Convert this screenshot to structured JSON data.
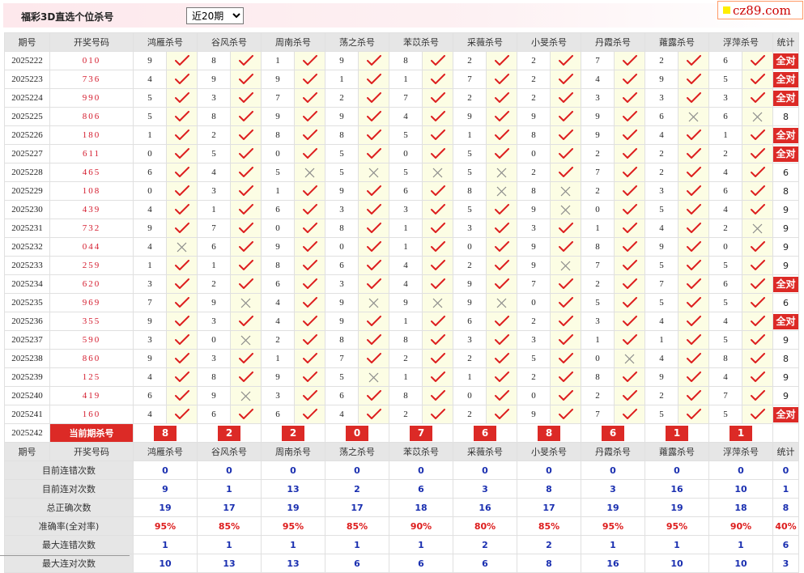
{
  "header": {
    "title": "福彩3D直选个位杀号",
    "period_select": {
      "selected": "近20期"
    },
    "logo_text": "cz89.com"
  },
  "table": {
    "headers": [
      "期号",
      "开奖号码",
      "鸿雁杀号",
      "谷风杀号",
      "周南杀号",
      "荡之杀号",
      "苯苡杀号",
      "采薇杀号",
      "小旻杀号",
      "丹霞杀号",
      "蕹露杀号",
      "浮萍杀号",
      "统计"
    ],
    "all_correct_label": "全对",
    "rows": [
      {
        "period": "2025222",
        "draw": "010",
        "kills": [
          9,
          8,
          1,
          9,
          8,
          2,
          2,
          7,
          2,
          6
        ],
        "marks": [
          1,
          1,
          1,
          1,
          1,
          1,
          1,
          1,
          1,
          1
        ],
        "stat": "全对"
      },
      {
        "period": "2025223",
        "draw": "736",
        "kills": [
          4,
          9,
          9,
          1,
          1,
          7,
          2,
          4,
          9,
          5
        ],
        "marks": [
          1,
          1,
          1,
          1,
          1,
          1,
          1,
          1,
          1,
          1
        ],
        "stat": "全对"
      },
      {
        "period": "2025224",
        "draw": "990",
        "kills": [
          5,
          3,
          7,
          2,
          7,
          2,
          2,
          3,
          3,
          3
        ],
        "marks": [
          1,
          1,
          1,
          1,
          1,
          1,
          1,
          1,
          1,
          1
        ],
        "stat": "全对"
      },
      {
        "period": "2025225",
        "draw": "806",
        "kills": [
          5,
          8,
          9,
          9,
          4,
          9,
          9,
          9,
          6,
          6
        ],
        "marks": [
          1,
          1,
          1,
          1,
          1,
          1,
          1,
          1,
          0,
          0
        ],
        "stat": "8"
      },
      {
        "period": "2025226",
        "draw": "180",
        "kills": [
          1,
          2,
          8,
          8,
          5,
          1,
          8,
          9,
          4,
          1
        ],
        "marks": [
          1,
          1,
          1,
          1,
          1,
          1,
          1,
          1,
          1,
          1
        ],
        "stat": "全对"
      },
      {
        "period": "2025227",
        "draw": "611",
        "kills": [
          0,
          5,
          0,
          5,
          0,
          5,
          0,
          2,
          2,
          2
        ],
        "marks": [
          1,
          1,
          1,
          1,
          1,
          1,
          1,
          1,
          1,
          1
        ],
        "stat": "全对"
      },
      {
        "period": "2025228",
        "draw": "465",
        "kills": [
          6,
          4,
          5,
          5,
          5,
          5,
          2,
          7,
          2,
          4
        ],
        "marks": [
          1,
          1,
          0,
          0,
          0,
          0,
          1,
          1,
          1,
          1
        ],
        "stat": "6"
      },
      {
        "period": "2025229",
        "draw": "108",
        "kills": [
          0,
          3,
          1,
          9,
          6,
          8,
          8,
          2,
          3,
          6
        ],
        "marks": [
          1,
          1,
          1,
          1,
          1,
          0,
          0,
          1,
          1,
          1
        ],
        "stat": "8"
      },
      {
        "period": "2025230",
        "draw": "439",
        "kills": [
          4,
          1,
          6,
          3,
          3,
          5,
          9,
          0,
          5,
          4
        ],
        "marks": [
          1,
          1,
          1,
          1,
          1,
          1,
          0,
          1,
          1,
          1
        ],
        "stat": "9"
      },
      {
        "period": "2025231",
        "draw": "732",
        "kills": [
          9,
          7,
          0,
          8,
          1,
          3,
          3,
          1,
          4,
          2
        ],
        "marks": [
          1,
          1,
          1,
          1,
          1,
          1,
          1,
          1,
          1,
          0
        ],
        "stat": "9"
      },
      {
        "period": "2025232",
        "draw": "044",
        "kills": [
          4,
          6,
          9,
          0,
          1,
          0,
          9,
          8,
          9,
          0
        ],
        "marks": [
          0,
          1,
          1,
          1,
          1,
          1,
          1,
          1,
          1,
          1
        ],
        "stat": "9"
      },
      {
        "period": "2025233",
        "draw": "259",
        "kills": [
          1,
          1,
          8,
          6,
          4,
          2,
          9,
          7,
          5,
          5
        ],
        "marks": [
          1,
          1,
          1,
          1,
          1,
          1,
          0,
          1,
          1,
          1
        ],
        "stat": "9"
      },
      {
        "period": "2025234",
        "draw": "620",
        "kills": [
          3,
          2,
          6,
          3,
          4,
          9,
          7,
          2,
          7,
          6
        ],
        "marks": [
          1,
          1,
          1,
          1,
          1,
          1,
          1,
          1,
          1,
          1
        ],
        "stat": "全对"
      },
      {
        "period": "2025235",
        "draw": "969",
        "kills": [
          7,
          9,
          4,
          9,
          9,
          9,
          0,
          5,
          5,
          5
        ],
        "marks": [
          1,
          0,
          1,
          0,
          0,
          0,
          1,
          1,
          1,
          1
        ],
        "stat": "6"
      },
      {
        "period": "2025236",
        "draw": "355",
        "kills": [
          9,
          3,
          4,
          9,
          1,
          6,
          2,
          3,
          4,
          4
        ],
        "marks": [
          1,
          1,
          1,
          1,
          1,
          1,
          1,
          1,
          1,
          1
        ],
        "stat": "全对"
      },
      {
        "period": "2025237",
        "draw": "590",
        "kills": [
          3,
          0,
          2,
          8,
          8,
          3,
          3,
          1,
          1,
          5
        ],
        "marks": [
          1,
          0,
          1,
          1,
          1,
          1,
          1,
          1,
          1,
          1
        ],
        "stat": "9"
      },
      {
        "period": "2025238",
        "draw": "860",
        "kills": [
          9,
          3,
          1,
          7,
          2,
          2,
          5,
          0,
          4,
          8
        ],
        "marks": [
          1,
          1,
          1,
          1,
          1,
          1,
          1,
          0,
          1,
          1
        ],
        "stat": "8"
      },
      {
        "period": "2025239",
        "draw": "125",
        "kills": [
          4,
          8,
          9,
          5,
          1,
          1,
          2,
          8,
          9,
          4
        ],
        "marks": [
          1,
          1,
          1,
          0,
          1,
          1,
          1,
          1,
          1,
          1
        ],
        "stat": "9"
      },
      {
        "period": "2025240",
        "draw": "419",
        "kills": [
          6,
          9,
          3,
          6,
          8,
          0,
          0,
          2,
          2,
          7
        ],
        "marks": [
          1,
          0,
          1,
          1,
          1,
          1,
          1,
          1,
          1,
          1
        ],
        "stat": "9"
      },
      {
        "period": "2025241",
        "draw": "160",
        "kills": [
          4,
          6,
          6,
          4,
          2,
          2,
          9,
          7,
          5,
          5
        ],
        "marks": [
          1,
          1,
          1,
          1,
          1,
          1,
          1,
          1,
          1,
          1
        ],
        "stat": "全对"
      }
    ],
    "current": {
      "period": "2025242",
      "label": "当前期杀号",
      "kills": [
        "8",
        "2",
        "2",
        "0",
        "7",
        "6",
        "8",
        "6",
        "1",
        "1"
      ]
    },
    "summary": [
      {
        "label": "目前连错次数",
        "values": [
          "0",
          "0",
          "0",
          "0",
          "0",
          "0",
          "0",
          "0",
          "0",
          "0"
        ],
        "stat": "0",
        "style": "val"
      },
      {
        "label": "目前连对次数",
        "values": [
          "9",
          "1",
          "13",
          "2",
          "6",
          "3",
          "8",
          "3",
          "16",
          "10"
        ],
        "stat": "1",
        "style": "val"
      },
      {
        "label": "总正确次数",
        "values": [
          "19",
          "17",
          "19",
          "17",
          "18",
          "16",
          "17",
          "19",
          "19",
          "18"
        ],
        "stat": "8",
        "style": "val"
      },
      {
        "label": "准确率(全对率)",
        "values": [
          "95%",
          "85%",
          "95%",
          "85%",
          "90%",
          "80%",
          "85%",
          "95%",
          "95%",
          "90%"
        ],
        "stat": "40%",
        "style": "rate"
      },
      {
        "label": "最大连错次数",
        "values": [
          "1",
          "1",
          "1",
          "1",
          "1",
          "2",
          "2",
          "1",
          "1",
          "1"
        ],
        "stat": "6",
        "style": "val"
      },
      {
        "label": "最大连对次数",
        "values": [
          "10",
          "13",
          "13",
          "6",
          "6",
          "6",
          "8",
          "16",
          "10",
          "10"
        ],
        "stat": "3",
        "style": "val"
      }
    ]
  },
  "colors": {
    "accent_red": "#dc2a26",
    "mark_bg": "#fcfde4",
    "summary_blue": "#1a2fb0",
    "header_grey": "#e6e6e6"
  },
  "icons": {
    "correct": "check-icon",
    "wrong": "cross-icon"
  }
}
